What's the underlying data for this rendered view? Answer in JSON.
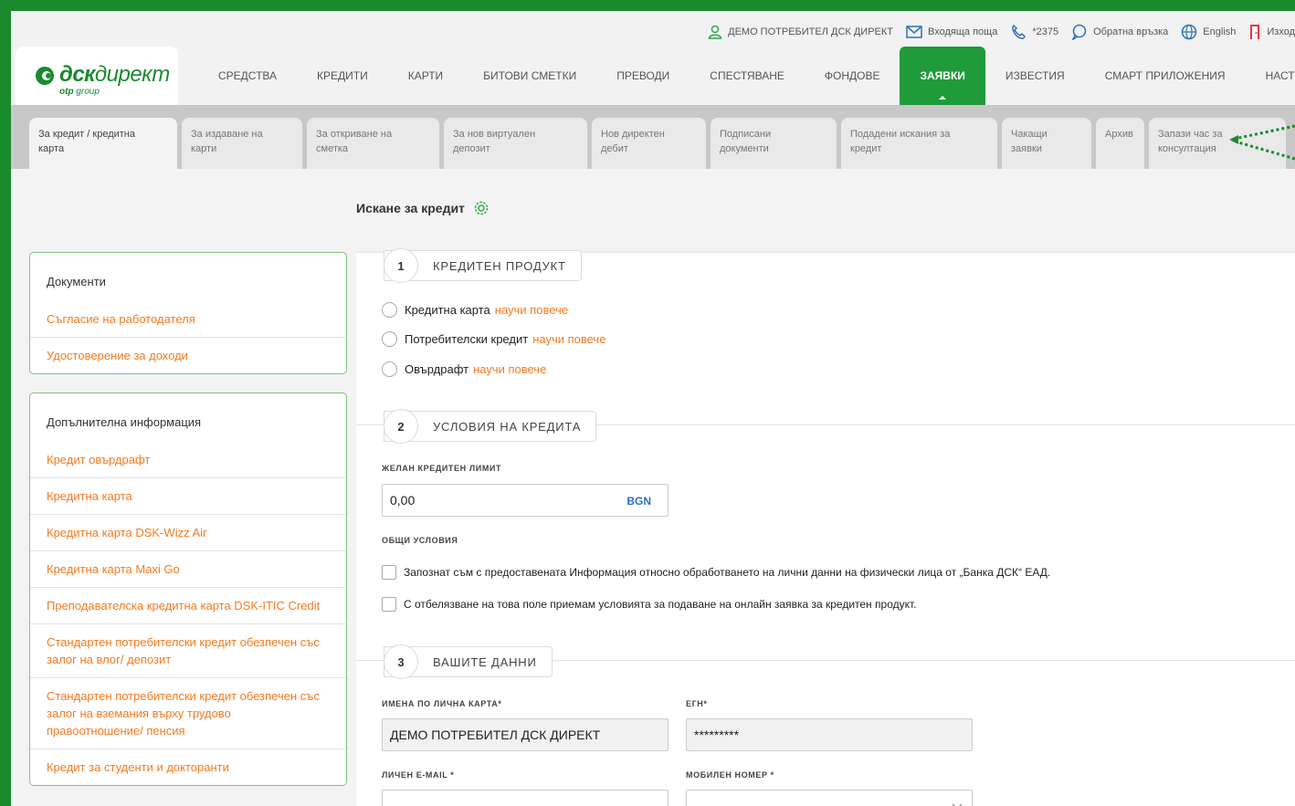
{
  "header": {
    "brand_bold": "дск",
    "brand_thin": "директ",
    "brand_sub_bold": "otp",
    "brand_sub": "group",
    "utility": {
      "user": "ДЕМО ПОТРЕБИТЕЛ ДСК ДИРЕКТ",
      "inbox": "Входяща поща",
      "phone": "*2375",
      "feedback": "Обратна връзка",
      "language": "English",
      "logout": "Изход"
    },
    "nav": [
      "СРЕДСТВА",
      "КРЕДИТИ",
      "КАРТИ",
      "БИТОВИ СМЕТКИ",
      "ПРЕВОДИ",
      "СПЕСТЯВАНЕ",
      "ФОНДОВЕ",
      "ЗАЯВКИ",
      "ИЗВЕСТИЯ",
      "СМАРТ ПРИЛОЖЕНИЯ",
      "НАСТРОЙКИ"
    ],
    "active_nav": "ЗАЯВКИ"
  },
  "subtabs": [
    {
      "l1": "За кредит / кредитна",
      "l2": "карта"
    },
    {
      "l1": "За издаване на",
      "l2": "карти"
    },
    {
      "l1": "За откриване на",
      "l2": "сметка"
    },
    {
      "l1": "За нов виртуален",
      "l2": "депозит"
    },
    {
      "l1": "Нов директен",
      "l2": "дебит"
    },
    {
      "l1": "Подписани",
      "l2": "документи"
    },
    {
      "l1": "Подадени искания за",
      "l2": "кредит"
    },
    {
      "l1": "Чакащи",
      "l2": "заявки"
    },
    {
      "l1": "Архив",
      "l2": ""
    },
    {
      "l1": "Запази час за",
      "l2": "консултация"
    }
  ],
  "page": {
    "title": "Искане за кредит"
  },
  "sidebar": {
    "documents": {
      "title": "Документи",
      "links": [
        "Съгласие на работодателя",
        "Удостоверение за доходи"
      ]
    },
    "additional": {
      "title": "Допълнителна информация",
      "links": [
        "Кредит овърдрафт",
        "Кредитна карта",
        "Кредитна карта DSK-Wizz Air",
        "Кредитна карта Maxi Go",
        "Преподавателска кредитна карта DSK-ITIC Credit",
        "Стандартен потребителски кредит обезпечен със залог на влог/ депозит",
        "Стандартен потребителски кредит обезпечен със залог на вземания върху трудово правоотношение/ пенсия",
        "Кредит за студенти и докторанти"
      ]
    }
  },
  "form": {
    "s1": {
      "num": "1",
      "label": "КРЕДИТЕН ПРОДУКТ"
    },
    "products": [
      {
        "label": "Кредитна карта",
        "more": "научи повече"
      },
      {
        "label": "Потребителски кредит",
        "more": "научи повече"
      },
      {
        "label": "Овърдрафт",
        "more": "научи повече"
      }
    ],
    "s2": {
      "num": "2",
      "label": "УСЛОВИЯ НА КРЕДИТА"
    },
    "limit_label": "ЖЕЛАН КРЕДИТЕН ЛИМИТ",
    "limit_value": "0,00",
    "currency": "BGN",
    "terms_label": "ОБЩИ УСЛОВИЯ",
    "checks": [
      "Запознат съм с предоставената Информация относно обработването на лични данни на физически лица от „Банка ДСК“ ЕАД.",
      "С отбелязване на това поле приемам условията за подаване на онлайн заявка за кредитен продукт."
    ],
    "s3": {
      "num": "3",
      "label": "ВАШИТЕ ДАННИ"
    },
    "name_label": "ИМЕНА ПО ЛИЧНА КАРТА*",
    "name_value": "ДЕМО ПОТРЕБИТЕЛ ДСК ДИРЕКТ",
    "egn_label": "ЕГН*",
    "egn_value": "*********",
    "email_label": "ЛИЧЕН E-MAIL *",
    "phone_label": "МОБИЛЕН НОМЕР *"
  },
  "colors": {
    "brand_green": "#1a8a2e",
    "active_tab": "#1f9b3a",
    "link_orange": "#f47a20"
  }
}
